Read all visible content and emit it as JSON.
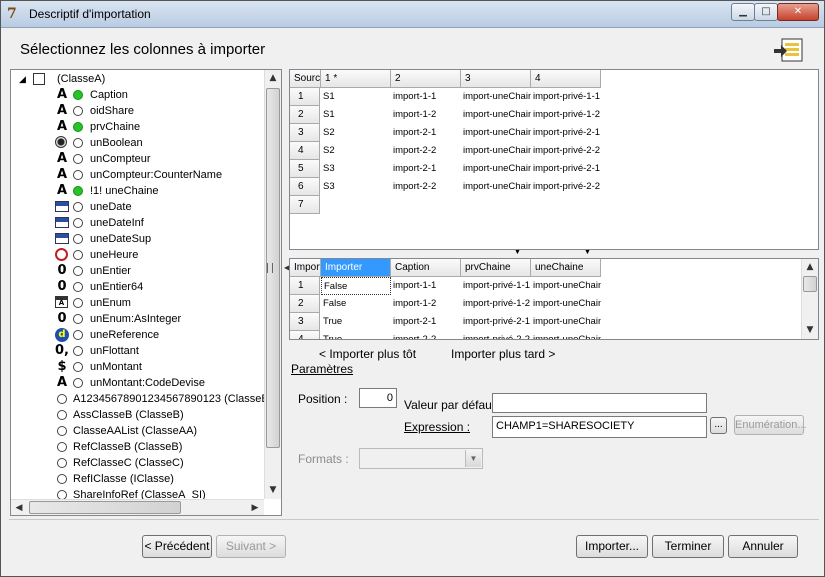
{
  "window": {
    "title": "Descriptif d'importation",
    "min": "▁",
    "max": "□",
    "close": "✕"
  },
  "header": {
    "title": "Sélectionnez les colonnes à importer"
  },
  "tree": {
    "root": "(ClasseA)",
    "items": [
      {
        "icon": "A",
        "dot": "green",
        "label": "Caption"
      },
      {
        "icon": "A",
        "dot": "white",
        "label": "oidShare"
      },
      {
        "icon": "A",
        "dot": "green",
        "label": "prvChaine"
      },
      {
        "icon": "◉",
        "dot": "white",
        "label": "unBoolean"
      },
      {
        "icon": "A",
        "dot": "white",
        "label": "unCompteur"
      },
      {
        "icon": "A",
        "dot": "white",
        "label": "unCompteur:CounterName"
      },
      {
        "icon": "A",
        "dot": "green",
        "label": "!1! uneChaine"
      },
      {
        "icon": "cal",
        "dot": "white",
        "label": "uneDate"
      },
      {
        "icon": "cal",
        "dot": "white",
        "label": "uneDateInf"
      },
      {
        "icon": "cal",
        "dot": "white",
        "label": "uneDateSup"
      },
      {
        "icon": "clock",
        "dot": "white",
        "label": "uneHeure"
      },
      {
        "icon": "0",
        "dot": "white",
        "label": "unEntier"
      },
      {
        "icon": "0",
        "dot": "white",
        "label": "unEntier64"
      },
      {
        "icon": "enum",
        "dot": "white",
        "label": "unEnum"
      },
      {
        "icon": "0",
        "dot": "white",
        "label": "unEnum:AsInteger"
      },
      {
        "icon": "d",
        "dot": "white",
        "label": "uneReference"
      },
      {
        "icon": "0,",
        "dot": "white",
        "label": "unFlottant"
      },
      {
        "icon": "$",
        "dot": "white",
        "label": "unMontant"
      },
      {
        "icon": "A",
        "dot": "white",
        "label": "unMontant:CodeDevise"
      },
      {
        "icon": "",
        "dot": "white",
        "label": "A12345678901234567890123 (ClasseB"
      },
      {
        "icon": "",
        "dot": "white",
        "label": "AssClasseB (ClasseB)"
      },
      {
        "icon": "",
        "dot": "white",
        "label": "ClasseAAList (ClasseAA)"
      },
      {
        "icon": "",
        "dot": "white",
        "label": "RefClasseB (ClasseB)"
      },
      {
        "icon": "",
        "dot": "white",
        "label": "RefClasseC (ClasseC)"
      },
      {
        "icon": "",
        "dot": "white",
        "label": "RefIClasse (IClasse)"
      },
      {
        "icon": "",
        "dot": "white",
        "label": "ShareInfoRef (ClasseA_SI)"
      }
    ]
  },
  "source_grid": {
    "headers": [
      "Source",
      "1 *",
      "2",
      "3",
      "4"
    ],
    "rows": [
      {
        "n": "1",
        "cells": [
          "S1",
          "import-1-1",
          "import-uneChain",
          "import-privé-1-1"
        ]
      },
      {
        "n": "2",
        "cells": [
          "S1",
          "import-1-2",
          "import-uneChain",
          "import-privé-1-2"
        ]
      },
      {
        "n": "3",
        "cells": [
          "S2",
          "import-2-1",
          "import-uneChain",
          "import-privé-2-1"
        ]
      },
      {
        "n": "4",
        "cells": [
          "S2",
          "import-2-2",
          "import-uneChain",
          "import-privé-2-2"
        ]
      },
      {
        "n": "5",
        "cells": [
          "S3",
          "import-2-1",
          "import-uneChain",
          "import-privé-2-1"
        ]
      },
      {
        "n": "6",
        "cells": [
          "S3",
          "import-2-2",
          "import-uneChain",
          "import-privé-2-2"
        ]
      },
      {
        "n": "7",
        "cells": [
          "",
          "",
          "",
          ""
        ]
      }
    ]
  },
  "import_grid": {
    "headers": [
      "Import",
      "Importer",
      "Caption",
      "prvChaine",
      "uneChaine"
    ],
    "rows": [
      {
        "n": "1",
        "cells": [
          "False",
          "import-1-1",
          "import-privé-1-1",
          "import-uneChain"
        ]
      },
      {
        "n": "2",
        "cells": [
          "False",
          "import-1-2",
          "import-privé-1-2",
          "import-uneChain"
        ]
      },
      {
        "n": "3",
        "cells": [
          "True",
          "import-2-1",
          "import-privé-2-1",
          "import-uneChain"
        ]
      },
      {
        "n": "4",
        "cells": [
          "True",
          "import-2-2",
          "import-privé-2-2",
          "import-uneChain"
        ]
      }
    ]
  },
  "nav": {
    "prev": "< Importer plus tôt",
    "next": "Importer plus tard >"
  },
  "params": {
    "link": "Paramètres",
    "position_label": "Position :",
    "position_value": "0",
    "default_label": "Valeur par défaut :",
    "default_value": "",
    "expression_label": "Expression :",
    "expression_value": "CHAMP1=SHARESOCIETY",
    "ellipsis": "...",
    "enum_button": "Enumération...",
    "formats_label": "Formats :",
    "formats_value": ""
  },
  "footer": {
    "prev": "< Précédent",
    "next": "Suivant >",
    "import": "Importer...",
    "finish": "Terminer",
    "cancel": "Annuler"
  },
  "colors": {
    "accent": "#3399ff",
    "green_dot": "#27c427",
    "title_grad_top": "#d9e4f1"
  }
}
